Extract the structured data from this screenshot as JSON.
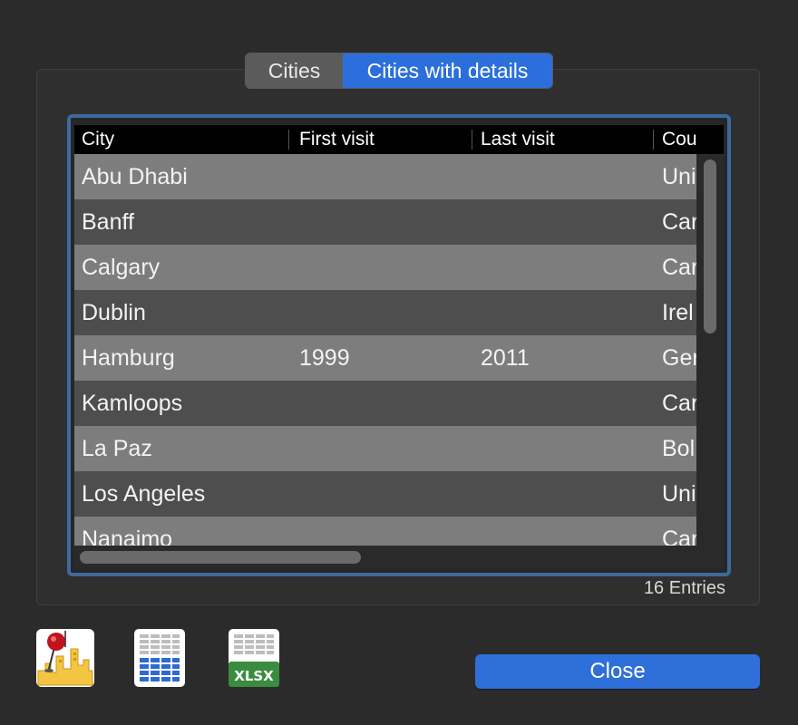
{
  "tabs": [
    {
      "label": "Cities",
      "selected": false
    },
    {
      "label": "Cities with details",
      "selected": true
    }
  ],
  "table": {
    "columns": [
      "City",
      "First visit",
      "Last visit",
      "Cou"
    ],
    "rows": [
      {
        "city": "Abu Dhabi",
        "first": "",
        "last": "",
        "country": "Uni"
      },
      {
        "city": "Banff",
        "first": "",
        "last": "",
        "country": "Car"
      },
      {
        "city": "Calgary",
        "first": "",
        "last": "",
        "country": "Car"
      },
      {
        "city": "Dublin",
        "first": "",
        "last": "",
        "country": "Irel"
      },
      {
        "city": "Hamburg",
        "first": "1999",
        "last": "2011",
        "country": "Ger"
      },
      {
        "city": "Kamloops",
        "first": "",
        "last": "",
        "country": "Car"
      },
      {
        "city": "La Paz",
        "first": "",
        "last": "",
        "country": "Bol"
      },
      {
        "city": "Los Angeles",
        "first": "",
        "last": "",
        "country": "Uni"
      },
      {
        "city": "Nanaimo",
        "first": "",
        "last": "",
        "country": "Car"
      }
    ]
  },
  "entries_label": "16 Entries",
  "icons": {
    "map": "map-pin-city-icon",
    "table_export": "table-export-icon",
    "xlsx_label": "XLSX"
  },
  "colors": {
    "accent": "#2f6fd9",
    "table_focus_ring": "#3d6a9c",
    "xlsx_green": "#3a8c3e"
  },
  "close_label": "Close"
}
